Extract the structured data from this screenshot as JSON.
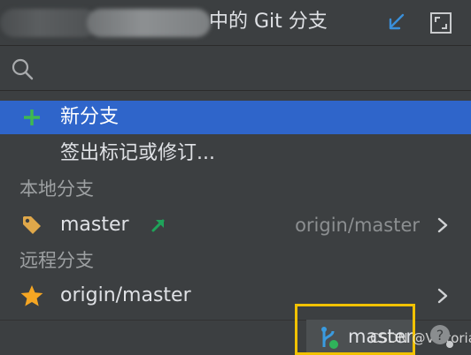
{
  "header": {
    "title": "中的 Git 分支",
    "icons": [
      "collapse-arrow-icon",
      "expand-window-icon"
    ]
  },
  "search": {
    "value": "",
    "placeholder": ""
  },
  "actions": [
    {
      "label": "新分支",
      "icon": "plus-icon",
      "selected": true
    },
    {
      "label": "签出标记或修订...",
      "icon": "",
      "selected": false
    }
  ],
  "local": {
    "header": "本地分支",
    "branches": [
      {
        "name": "master",
        "tracking": "origin/master",
        "icon": "tag-icon",
        "push_indicator": "push-arrow-icon"
      }
    ]
  },
  "remote": {
    "header": "远程分支",
    "branches": [
      {
        "name": "origin/master",
        "icon": "star-icon"
      }
    ]
  },
  "statusbar": {
    "branch": "master",
    "watermark": "CSDN @Viktoriae",
    "icons": [
      "git-branch-icon",
      "help-icon"
    ]
  },
  "colors": {
    "background": "#3c3f41",
    "selection": "#2f65ca",
    "plus": "#3fb950",
    "tag": "#e0a84a",
    "star": "#f5a623",
    "push_arrow": "#1fa35a",
    "highlight_box": "#f2c200",
    "header_icon_blue": "#3a8fd9"
  }
}
